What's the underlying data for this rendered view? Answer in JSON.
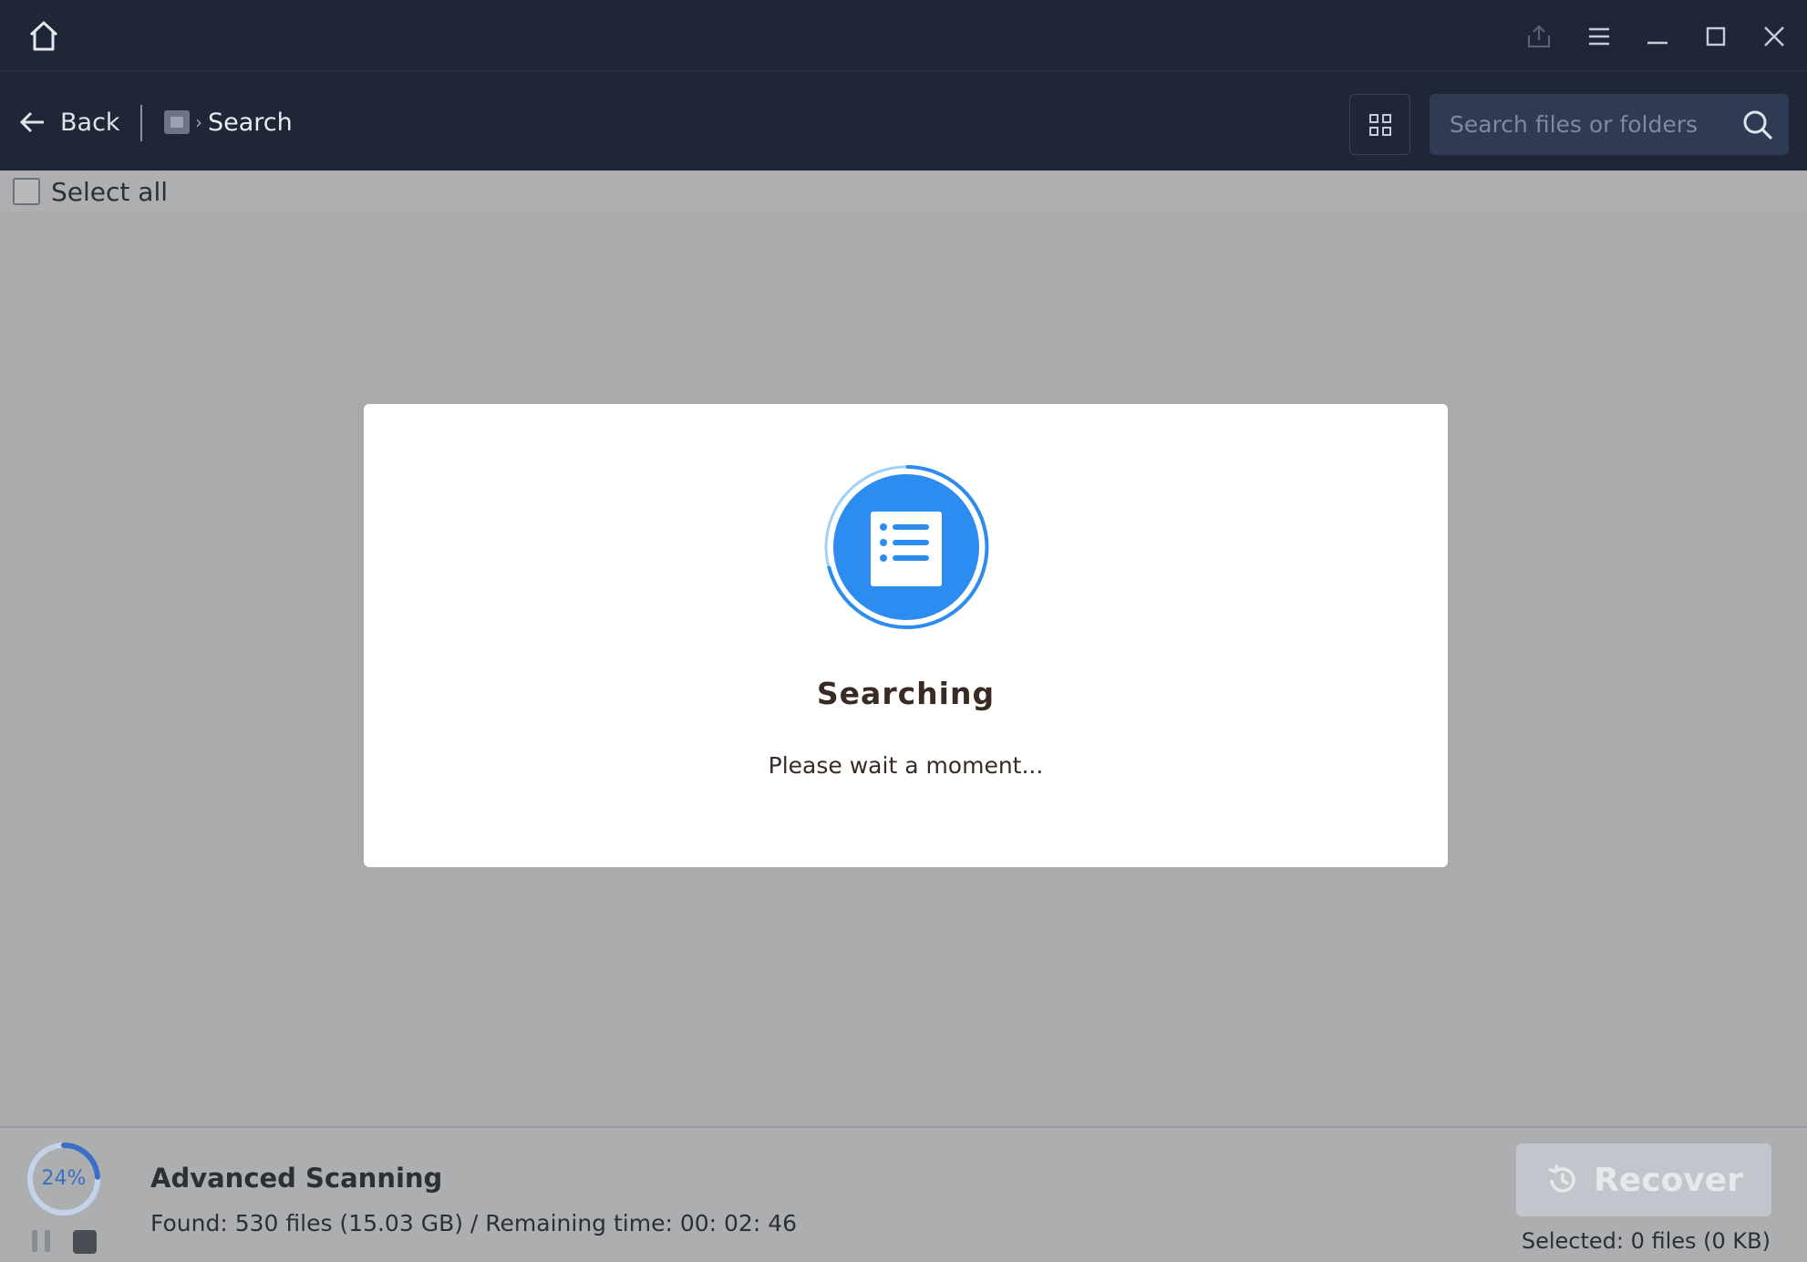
{
  "titlebar": {
    "icons": [
      "home-icon",
      "export-icon",
      "menu-icon",
      "minimize-icon",
      "maximize-icon",
      "close-icon"
    ]
  },
  "toolbar": {
    "back_label": "Back",
    "breadcrumb": {
      "separator": "›",
      "current": "Search"
    },
    "search_placeholder": "Search files or folders"
  },
  "selectbar": {
    "select_all_label": "Select all"
  },
  "dialog": {
    "title": "Searching",
    "subtitle": "Please wait a moment...",
    "accent_color": "#2d8cf0"
  },
  "footer": {
    "progress_percent": "24%",
    "progress_value": 24,
    "scan_title": "Advanced Scanning",
    "scan_stats": "Found: 530 files (15.03 GB) / Remaining time: 00: 02: 46",
    "recover_label": "Recover",
    "selected_info": "Selected: 0 files (0 KB)"
  },
  "colors": {
    "header_bg": "#1f2637",
    "search_bg": "#2f3a55",
    "overlay_bg": "#a9aaac",
    "progress_color": "#3b6fc6"
  }
}
